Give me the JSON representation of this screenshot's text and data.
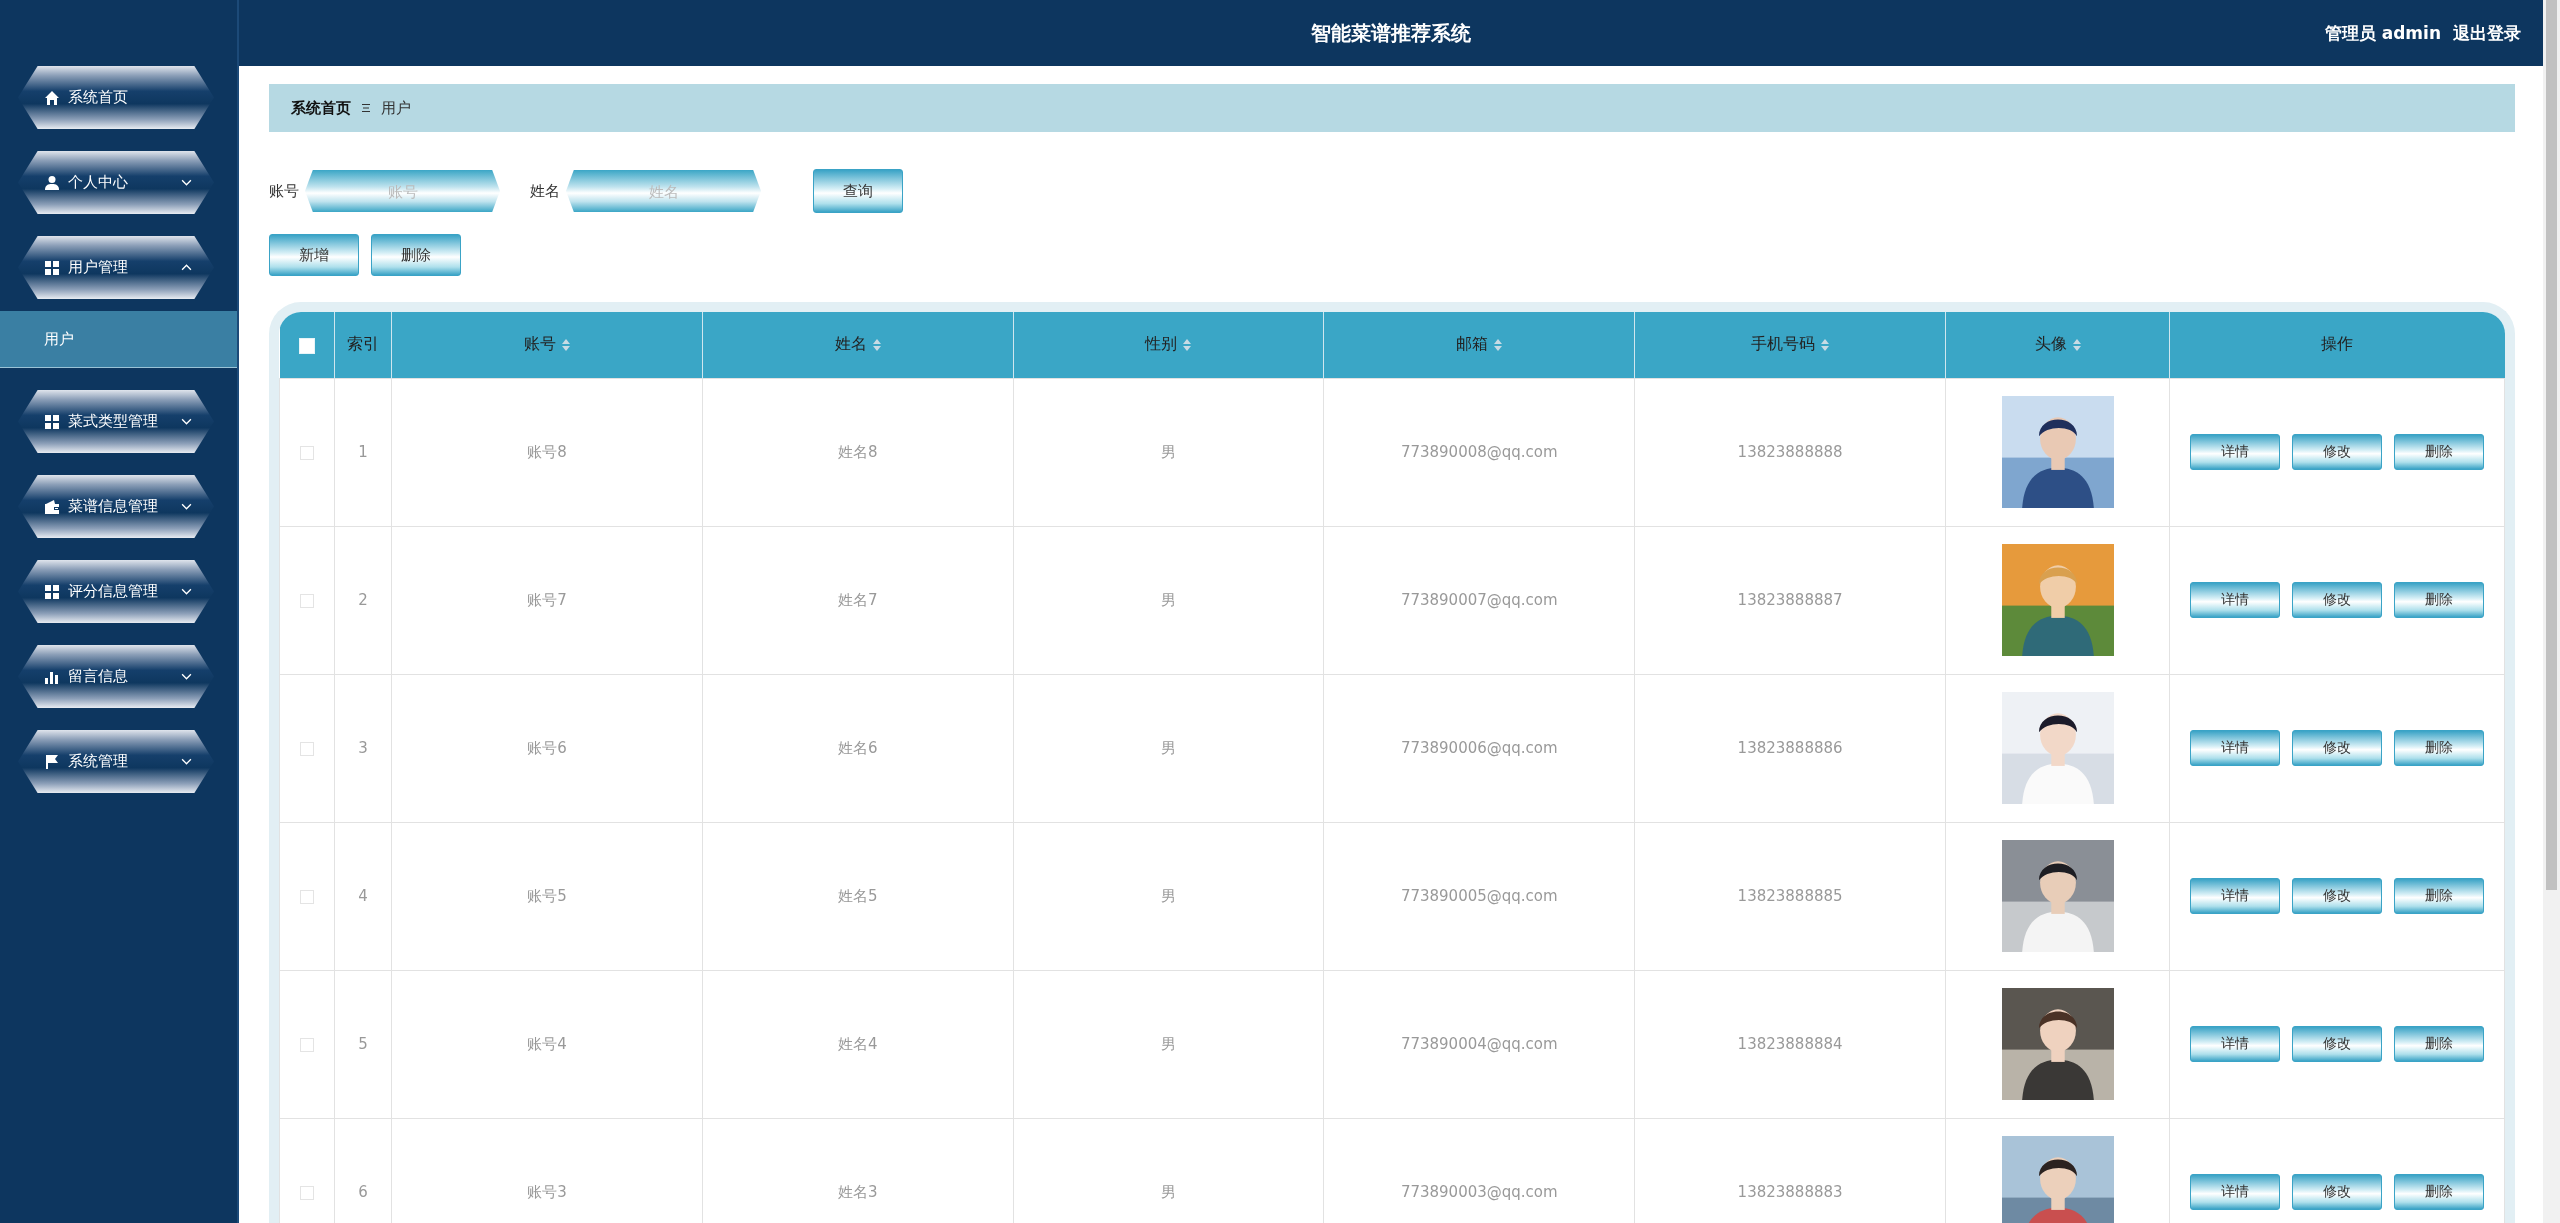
{
  "header": {
    "title": "智能菜谱推荐系统",
    "user": "管理员 admin",
    "logout": "退出登录"
  },
  "sidebar": {
    "items": [
      {
        "label": "系统首页",
        "expandable": false
      },
      {
        "label": "个人中心",
        "expandable": true,
        "expanded": false
      },
      {
        "label": "用户管理",
        "expandable": true,
        "expanded": true,
        "children": [
          {
            "label": "用户",
            "selected": true
          }
        ]
      },
      {
        "label": "菜式类型管理",
        "expandable": true,
        "expanded": false
      },
      {
        "label": "菜谱信息管理",
        "expandable": true,
        "expanded": false
      },
      {
        "label": "评分信息管理",
        "expandable": true,
        "expanded": false
      },
      {
        "label": "留言信息",
        "expandable": true,
        "expanded": false
      },
      {
        "label": "系统管理",
        "expandable": true,
        "expanded": false
      }
    ]
  },
  "breadcrumb": [
    "系统首页",
    "用户"
  ],
  "search": {
    "fields": [
      {
        "label": "账号",
        "placeholder": "账号"
      },
      {
        "label": "姓名",
        "placeholder": "姓名"
      }
    ],
    "button": "查询"
  },
  "actions": [
    "新增",
    "删除"
  ],
  "table": {
    "header_checked": false,
    "columns": [
      {
        "label": "索引",
        "sortable": false
      },
      {
        "label": "账号",
        "sortable": true
      },
      {
        "label": "姓名",
        "sortable": true
      },
      {
        "label": "性别",
        "sortable": true
      },
      {
        "label": "邮箱",
        "sortable": true
      },
      {
        "label": "手机号码",
        "sortable": true
      },
      {
        "label": "头像",
        "sortable": true
      },
      {
        "label": "操作",
        "sortable": false
      }
    ],
    "rows": [
      {
        "checked": false,
        "index": "1",
        "account": "账号8",
        "name": "姓名8",
        "gender": "男",
        "email": "773890008@qq.com",
        "phone": "13823888888",
        "buttons": [
          "详情",
          "修改",
          "删除"
        ]
      },
      {
        "checked": false,
        "index": "2",
        "account": "账号7",
        "name": "姓名7",
        "gender": "男",
        "email": "773890007@qq.com",
        "phone": "13823888887",
        "buttons": [
          "详情",
          "修改",
          "删除"
        ]
      },
      {
        "checked": false,
        "index": "3",
        "account": "账号6",
        "name": "姓名6",
        "gender": "男",
        "email": "773890006@qq.com",
        "phone": "13823888886",
        "buttons": [
          "详情",
          "修改",
          "删除"
        ]
      },
      {
        "checked": false,
        "index": "4",
        "account": "账号5",
        "name": "姓名5",
        "gender": "男",
        "email": "773890005@qq.com",
        "phone": "13823888885",
        "buttons": [
          "详情",
          "修改",
          "删除"
        ]
      },
      {
        "checked": false,
        "index": "5",
        "account": "账号4",
        "name": "姓名4",
        "gender": "男",
        "email": "773890004@qq.com",
        "phone": "13823888884",
        "buttons": [
          "详情",
          "修改",
          "删除"
        ]
      },
      {
        "checked": false,
        "index": "6",
        "account": "账号3",
        "name": "姓名3",
        "gender": "男",
        "email": "773890003@qq.com",
        "phone": "13823888883",
        "buttons": [
          "详情",
          "修改",
          "删除"
        ]
      }
    ]
  }
}
